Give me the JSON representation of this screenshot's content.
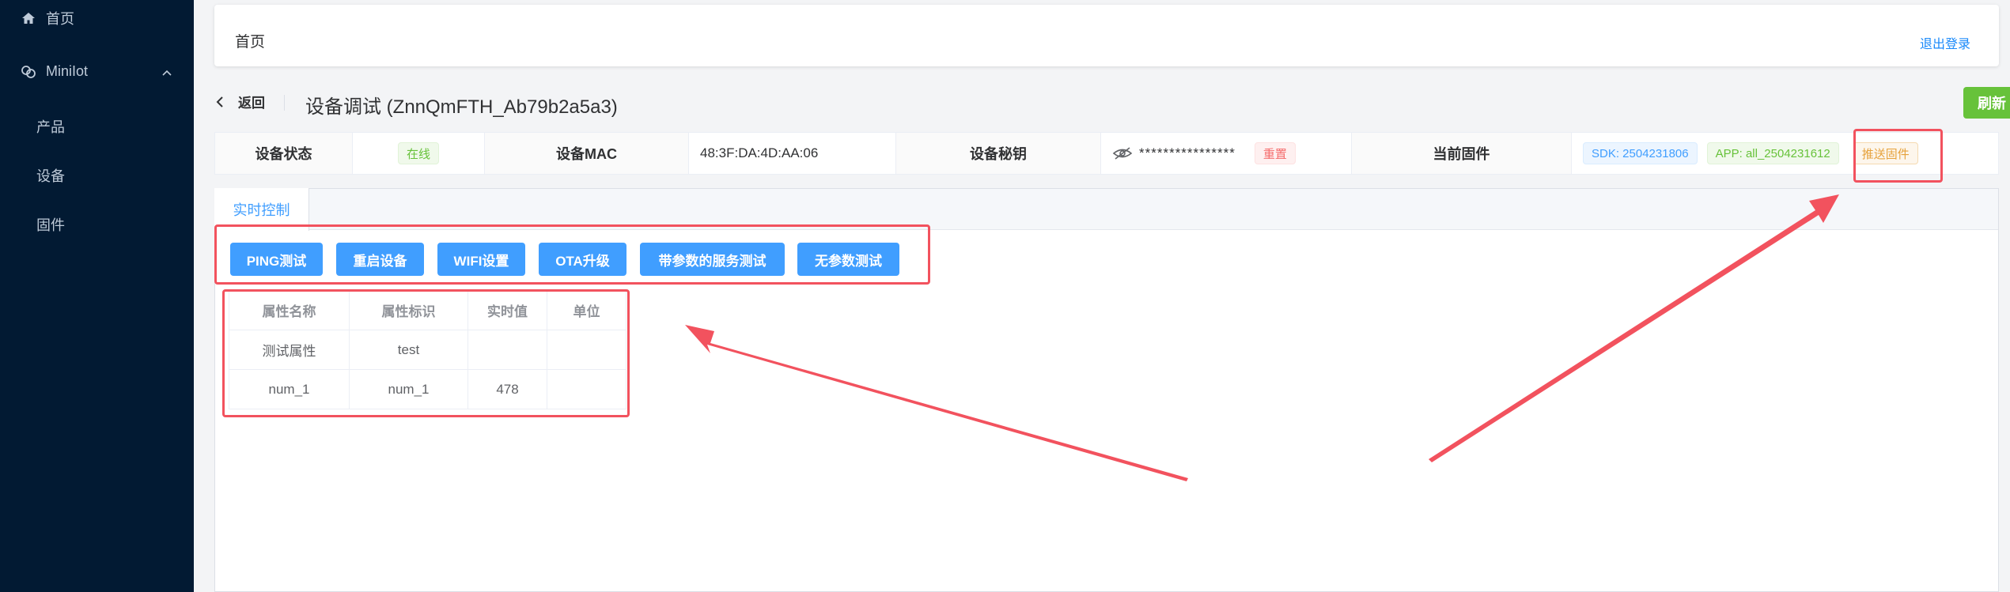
{
  "sidebar": {
    "home_label": "首页",
    "minilot_label": "MiniIot",
    "sub_items": [
      {
        "label": "产品",
        "icon": "none"
      },
      {
        "label": "设备",
        "icon": "none"
      },
      {
        "label": "固件",
        "icon": "none"
      }
    ],
    "bg_color": "#021a33"
  },
  "topbar": {
    "breadcrumb": "首页",
    "logout": "退出登录"
  },
  "header": {
    "back": "返回",
    "title": "设备调试 (ZnnQmFTH_Ab79b2a5a3)",
    "refresh": "刷新"
  },
  "device": {
    "status_label": "设备状态",
    "status_value": "在线",
    "mac_label": "设备MAC",
    "mac_value": "48:3F:DA:4D:AA:06",
    "secret_label": "设备秘钥",
    "secret_value": "****************",
    "reset_button": "重置",
    "firmware_label": "当前固件",
    "sdk_tag": "SDK: 2504231806",
    "app_tag": "APP: all_2504231612",
    "push_button": "推送固件"
  },
  "tabs": {
    "active": "实时控制"
  },
  "actions": [
    "PING测试",
    "重启设备",
    "WIFI设置",
    "OTA升级",
    "带参数的服务测试",
    "无参数测试"
  ],
  "table": {
    "headers": [
      "属性名称",
      "属性标识",
      "实时值",
      "单位"
    ],
    "rows": [
      [
        "测试属性",
        "test",
        "",
        ""
      ],
      [
        "num_1",
        "num_1",
        "478",
        ""
      ]
    ]
  },
  "colors": {
    "primary": "#409eff",
    "success": "#67c23a",
    "annotation": "#f2525e"
  }
}
